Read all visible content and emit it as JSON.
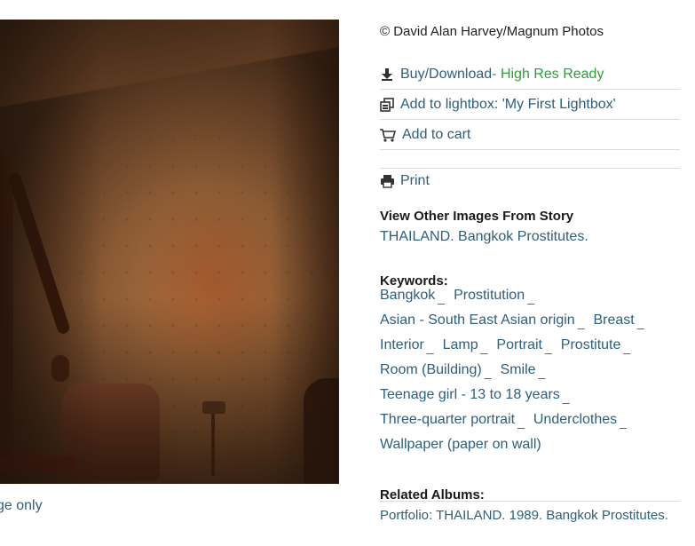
{
  "photo": {
    "caption_fragment": "ge only"
  },
  "details": {
    "credit": "© David Alan Harvey/Magnum Photos",
    "actions": {
      "buy_label": "Buy/Download",
      "buy_status": " - High Res Ready",
      "lightbox_label": "Add to lightbox: 'My First Lightbox'",
      "cart_label": "Add to cart",
      "print_label": "Print"
    },
    "story": {
      "heading": "View Other Images From Story",
      "link": "THAILAND. Bangkok Prostitutes."
    },
    "keywords": {
      "heading": "Keywords:",
      "separator": "_",
      "items": [
        "Bangkok",
        "Prostitution",
        "Asian - South East Asian origin",
        "Breast",
        "Interior",
        "Lamp",
        "Portrait",
        "Prostitute",
        "Room (Building)",
        "Smile",
        "Teenage girl - 13 to 18 years",
        "Three-quarter portrait",
        "Underclothes",
        "Wallpaper (paper on wall)"
      ]
    },
    "albums": {
      "heading": "Related Albums:",
      "link": "Portfolio: THAILAND. 1989. Bangkok Prostitutes."
    }
  },
  "colors": {
    "link": "#2f5f7a",
    "ready": "#2d9e3a"
  },
  "icons": {
    "download": "download-icon",
    "lightbox": "lightbox-icon",
    "cart": "cart-icon",
    "print": "print-icon"
  }
}
